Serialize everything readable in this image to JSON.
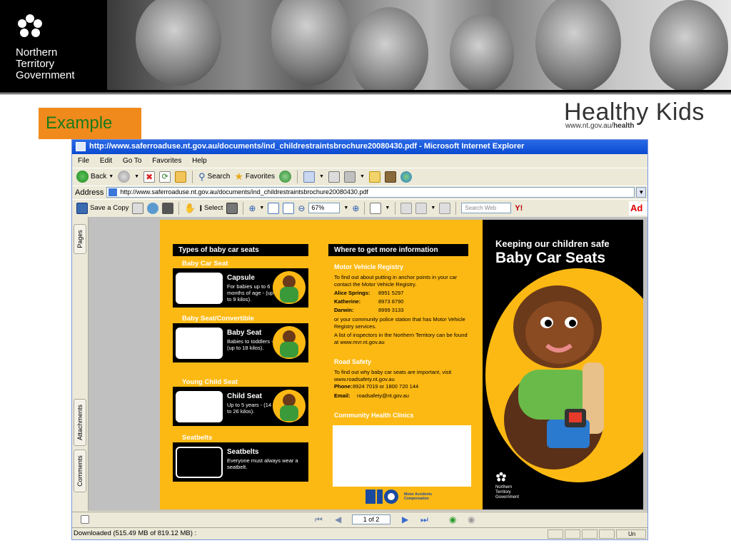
{
  "slide": {
    "logo_lines": [
      "Northern",
      "Territory",
      "Government"
    ],
    "example_label": "Example",
    "brand_title": "Healthy Kids",
    "brand_url_prefix": "www.nt.gov.au/",
    "brand_url_suffix": "health"
  },
  "browser": {
    "window_title": "http://www.saferroaduse.nt.gov.au/documents/ind_childrestraintsbrochure20080430.pdf - Microsoft Internet Explorer",
    "menu": [
      "File",
      "Edit",
      "Go To",
      "Favorites",
      "Help"
    ],
    "toolbar": {
      "back": "Back",
      "search": "Search",
      "favorites": "Favorites"
    },
    "address_label": "Address",
    "address_value": "http://www.saferroaduse.nt.gov.au/documents/ind_childrestraintsbrochure20080430.pdf",
    "pdf_toolbar": {
      "save_copy": "Save a Copy",
      "select": "Select",
      "zoom": "67%",
      "search_placeholder": "Search Web",
      "yahoo": "Y!",
      "ad": "Ad"
    },
    "side_tabs": [
      "Pages",
      "Attachments",
      "Comments"
    ],
    "page_indicator": "1 of 2",
    "status_text": "Downloaded  (515.49 MB of 819.12 MB) :",
    "status_right": "Un"
  },
  "brochure": {
    "types_heading": "Types of baby car seats",
    "seats": [
      {
        "section": "Baby Car Seat",
        "title": "Capsule",
        "desc": "For babies up to 6 months of age - (up to 9 kilos)."
      },
      {
        "section": "Baby Seat/Convertible",
        "title": "Baby Seat",
        "desc": "Babies to toddlers - (up to 18 kilos)."
      },
      {
        "section": "Young Child Seat",
        "title": "Child Seat",
        "desc": "Up to 5 years - (14 to 26 kilos)."
      },
      {
        "section": "Seatbelts",
        "title": "Seatbelts",
        "desc": "Everyone must always wear a seatbelt."
      }
    ],
    "info_heading": "Where to get more information",
    "mvr_heading": "Motor Vehicle Registry",
    "mvr_text": "To find out about putting in anchor points in your car contact the Motor Vehicle Registry.",
    "contacts": [
      {
        "place": "Alice Springs:",
        "phone": "8951 5297"
      },
      {
        "place": "Katherine:",
        "phone": "8973 8790"
      },
      {
        "place": "Darwin:",
        "phone": "8999 3133"
      }
    ],
    "police_text": "or your community police station that has Motor Vehicle Registry services.",
    "inspectors_text": "A list of inspectors in the Northern Territory can be found at www.mvr.nt.gov.au",
    "rs_heading": "Road Safety",
    "rs_text": "To find out why baby car seats are important, visit www.roadsafety.nt.gov.au",
    "rs_phone_label": "Phone:",
    "rs_phone": "8924 7019 or 1800 720 144",
    "rs_email_label": "Email:",
    "rs_email": "roadsafety@nt.gov.au",
    "chc_heading": "Community Health Clinics",
    "tio_text": "Motor Accidents Compensation",
    "cover_subtitle": "Keeping our children safe",
    "cover_title": "Baby Car Seats",
    "cover_logo": [
      "Northern",
      "Territory",
      "Government"
    ]
  },
  "colors": {
    "brochure_yellow": "#fdb913",
    "example_orange": "#f08a1c",
    "example_text_green": "#1a7a1a",
    "ie_title_blue": "#0a4ad0"
  }
}
